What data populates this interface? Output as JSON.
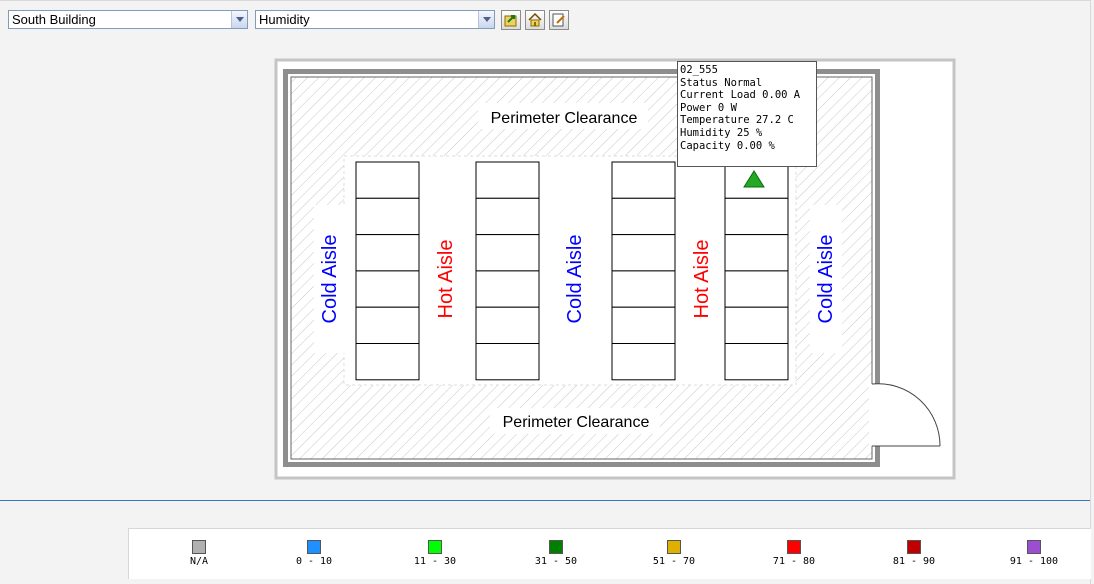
{
  "toolbar": {
    "building_select": "South Building",
    "metric_select": "Humidity",
    "buttons": [
      {
        "name": "export-button",
        "icon": "export-icon"
      },
      {
        "name": "home-button",
        "icon": "home-icon"
      },
      {
        "name": "edit-button",
        "icon": "edit-icon"
      }
    ]
  },
  "floorplan": {
    "perimeter_top": "Perimeter Clearance",
    "perimeter_bottom": "Perimeter Clearance",
    "aisles": [
      {
        "label": "Cold Aisle",
        "color": "#0000ff"
      },
      {
        "label": "Hot Aisle",
        "color": "#ff0000"
      },
      {
        "label": "Cold Aisle",
        "color": "#0000ff"
      },
      {
        "label": "Hot Aisle",
        "color": "#ff0000"
      },
      {
        "label": "Cold Aisle",
        "color": "#0000ff"
      }
    ],
    "sensor_marker": {
      "icon": "triangle-icon",
      "color": "#22aa22"
    }
  },
  "tooltip": {
    "id": "02_555",
    "status": "Status Normal",
    "current_load": "Current Load 0.00 A",
    "power": "Power 0 W",
    "temperature": "Temperature 27.2 C",
    "humidity": "Humidity 25 %",
    "capacity": "Capacity 0.00 %"
  },
  "legend": [
    {
      "label": "N/A",
      "color": "#b0b0b0"
    },
    {
      "label": "0 - 10",
      "color": "#1e90ff"
    },
    {
      "label": "11 - 30",
      "color": "#00ff00"
    },
    {
      "label": "31 - 50",
      "color": "#008000"
    },
    {
      "label": "51 - 70",
      "color": "#e0b000"
    },
    {
      "label": "71 - 80",
      "color": "#ff0000"
    },
    {
      "label": "81 - 90",
      "color": "#c00000"
    },
    {
      "label": "91 - 100",
      "color": "#9b4fd0"
    }
  ]
}
